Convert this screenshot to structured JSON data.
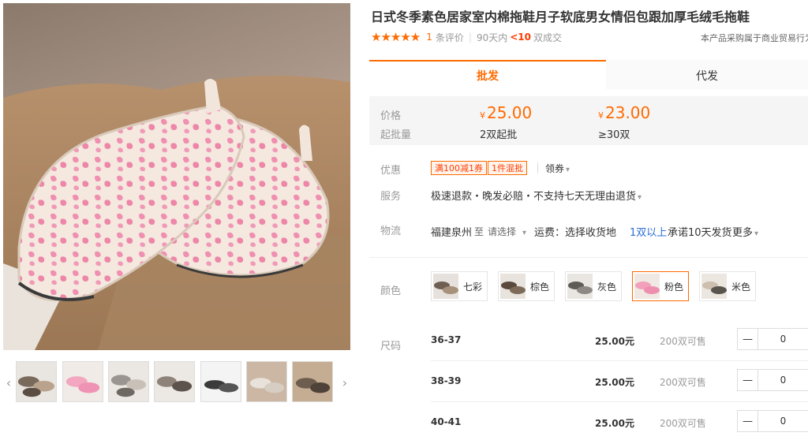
{
  "product": {
    "title": "日式冬季素色居家室内棉拖鞋月子软底男女情侣包跟加厚毛绒毛拖鞋"
  },
  "rating": {
    "stars": "★★★★★",
    "review_count": "1",
    "review_label": "条评价",
    "period_label": "90天内",
    "deals_value": "<10",
    "deals_label": "双成交"
  },
  "purchase_tip": "本产品采购属于商业贸易行为",
  "tabs": {
    "wholesale": "批发",
    "dropship": "代发"
  },
  "price_box": {
    "price_label": "价格",
    "moq_label": "起批量",
    "currency": "¥",
    "tiers": [
      {
        "price": "25.00",
        "qty": "2双起批"
      },
      {
        "price": "23.00",
        "qty": "≥30双"
      }
    ]
  },
  "promo": {
    "label": "优惠",
    "coupons": [
      "满100减1券",
      "1件混批"
    ],
    "get_coupon": "领券"
  },
  "service": {
    "label": "服务",
    "text": "极速退款・晚发必赔・不支持七天无理由退货"
  },
  "logistics": {
    "label": "物流",
    "origin": "福建泉州",
    "to": "至",
    "select": "请选择",
    "shipping_fee": "运费：选择收货地",
    "qty_rule": "1双以上",
    "promise": "承诺10天发货",
    "more": "更多"
  },
  "colors": {
    "label": "颜色",
    "options": [
      {
        "name": "七彩",
        "selected": false
      },
      {
        "name": "棕色",
        "selected": false
      },
      {
        "name": "灰色",
        "selected": false
      },
      {
        "name": "粉色",
        "selected": true
      },
      {
        "name": "米色",
        "selected": false
      }
    ]
  },
  "sizes": {
    "label": "尺码",
    "rows": [
      {
        "name": "36-37",
        "price": "25.00元",
        "stock": "200双可售",
        "qty": "0"
      },
      {
        "name": "38-39",
        "price": "25.00元",
        "stock": "200双可售",
        "qty": "0"
      },
      {
        "name": "40-41",
        "price": "25.00元",
        "stock": "200双可售",
        "qty": "0"
      }
    ]
  },
  "stepper": {
    "minus": "—"
  },
  "gallery": {
    "arrow_left": "‹",
    "arrow_right": "›",
    "thumb_count": 7
  },
  "colors_theme": {
    "accent": "#ff6a00",
    "price_red": "#ff3b00",
    "link_blue": "#2b6fd6"
  },
  "icons": [
    "star-icon",
    "chevron-down-icon",
    "chevron-left-icon",
    "chevron-right-icon",
    "minus-icon"
  ]
}
